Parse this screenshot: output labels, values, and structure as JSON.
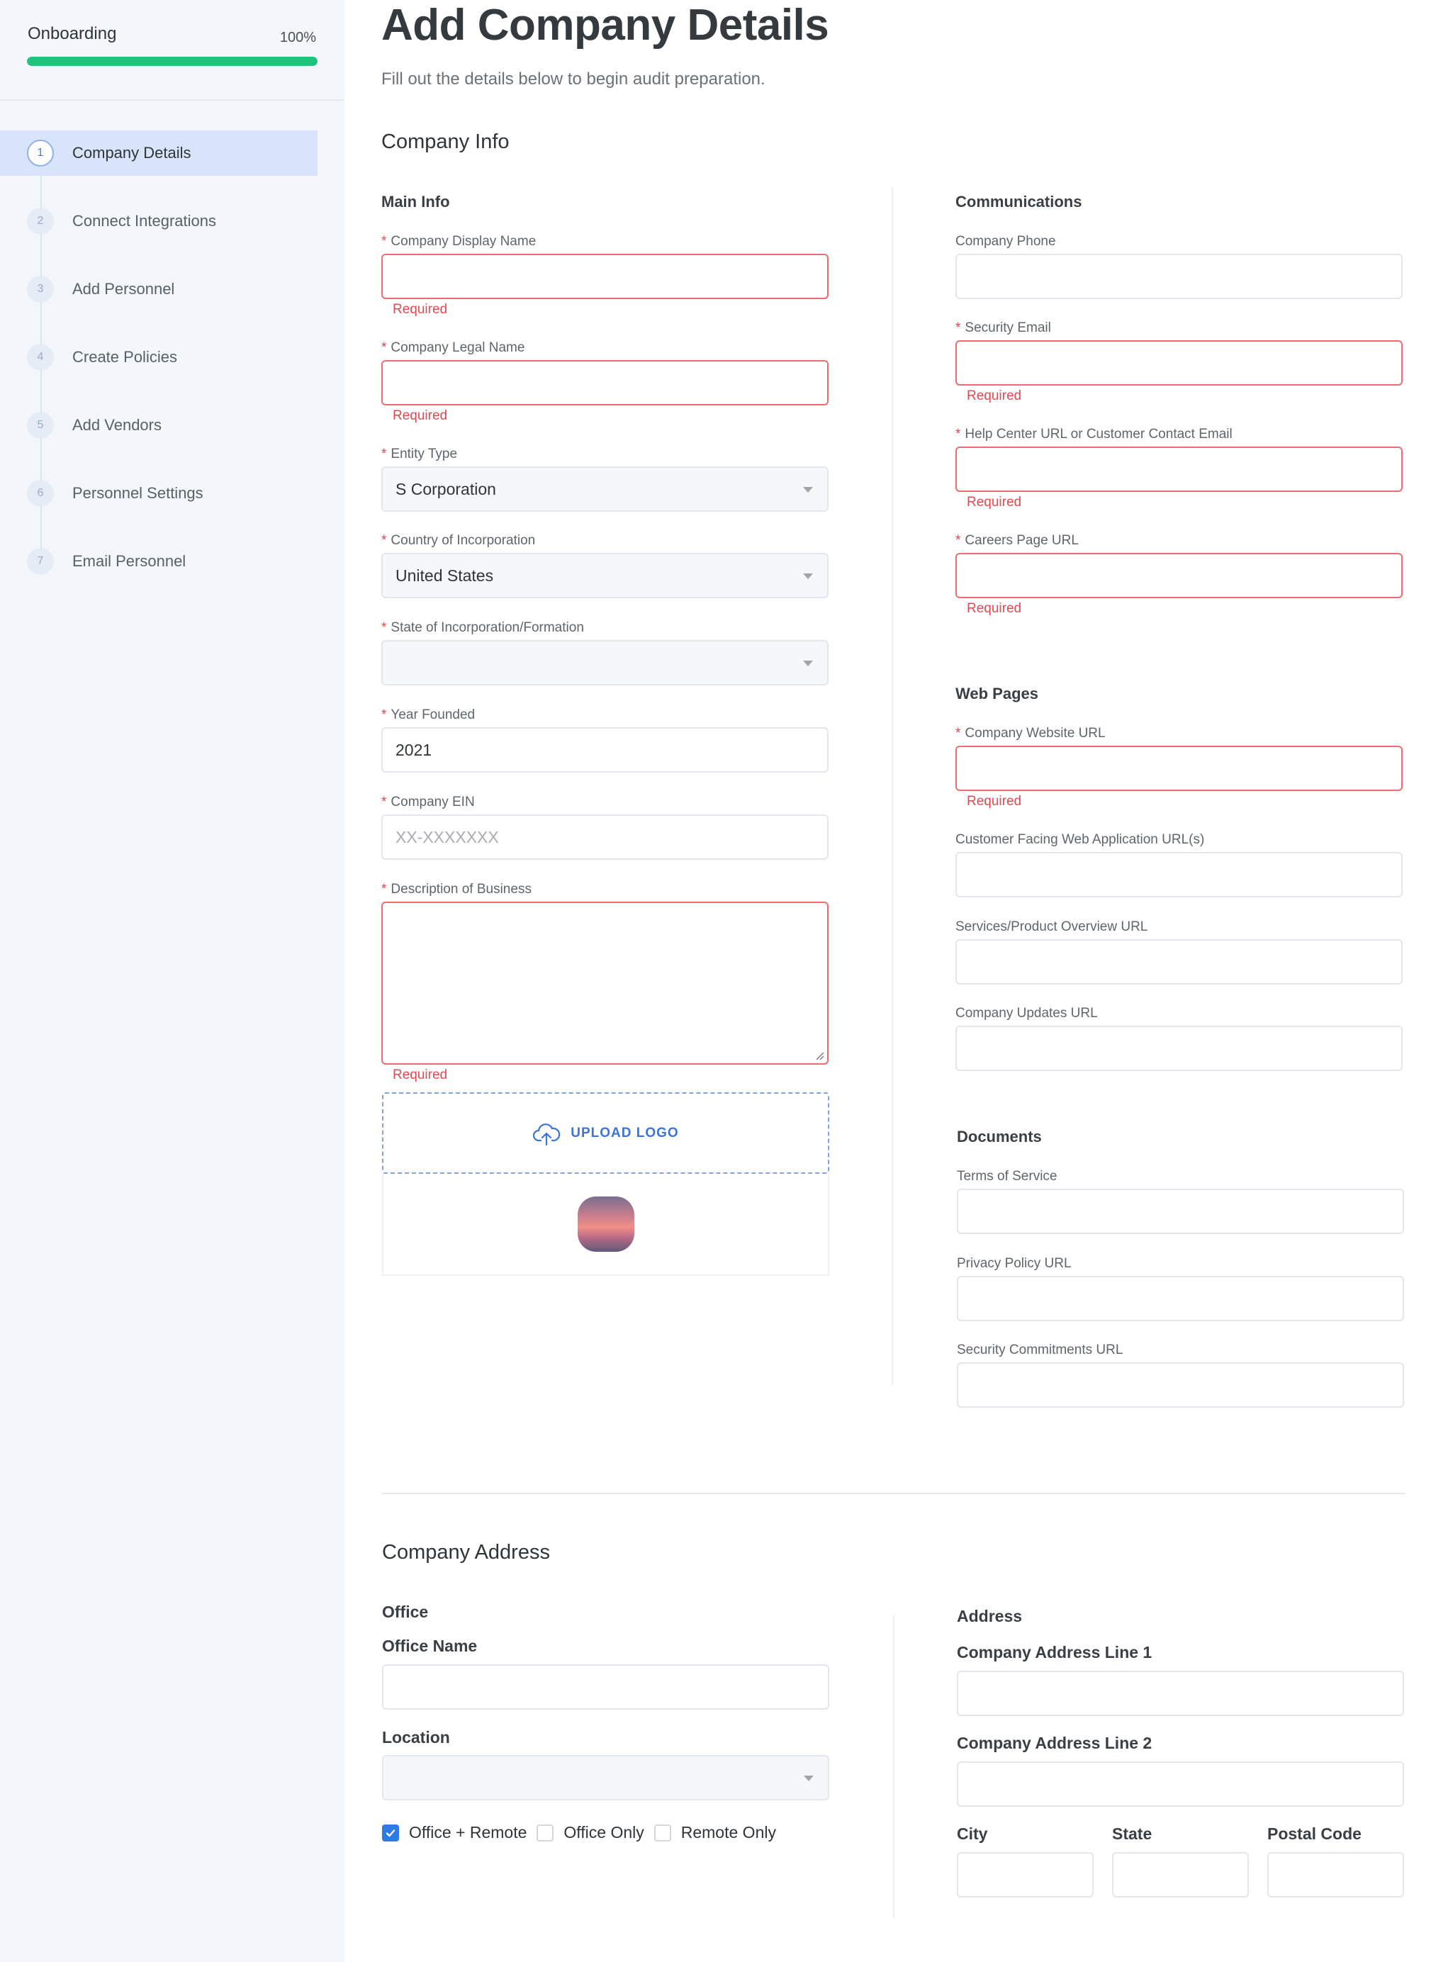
{
  "sidebar": {
    "title": "Onboarding",
    "progress_percent": "100%",
    "progress_value": 1.0,
    "steps": [
      {
        "num": "1",
        "label": "Company Details"
      },
      {
        "num": "2",
        "label": "Connect Integrations"
      },
      {
        "num": "3",
        "label": "Add Personnel"
      },
      {
        "num": "4",
        "label": "Create Policies"
      },
      {
        "num": "5",
        "label": "Add Vendors"
      },
      {
        "num": "6",
        "label": "Personnel Settings"
      },
      {
        "num": "7",
        "label": "Email Personnel"
      }
    ],
    "active_step": 1
  },
  "page": {
    "title": "Add Company Details",
    "subtitle": "Fill out the details below to begin audit preparation."
  },
  "company_info": {
    "title": "Company Info",
    "main_info": {
      "title": "Main Info",
      "display_name_label": "Company Display Name",
      "legal_name_label": "Company Legal Name",
      "entity_type_label": "Entity Type",
      "entity_type_value": "S Corporation",
      "country_label": "Country of Incorporation",
      "country_value": "United States",
      "state_label": "State of Incorporation/Formation",
      "state_value": "",
      "year_label": "Year Founded",
      "year_value": "2021",
      "ein_label": "Company EIN",
      "ein_placeholder": "XX-XXXXXXX",
      "description_label": "Description of Business",
      "upload_label": "UPLOAD LOGO"
    },
    "communications": {
      "title": "Communications",
      "phone_label": "Company Phone",
      "security_email_label": "Security Email",
      "help_center_label": "Help Center URL or Customer Contact Email",
      "careers_label": "Careers Page URL"
    },
    "web_pages": {
      "title": "Web Pages",
      "website_label": "Company Website URL",
      "web_app_label": "Customer Facing Web Application URL(s)",
      "overview_label": "Services/Product Overview URL",
      "updates_label": "Company Updates URL"
    },
    "documents": {
      "title": "Documents",
      "tos_label": "Terms of Service",
      "privacy_label": "Privacy Policy URL",
      "security_commitments_label": "Security Commitments URL"
    },
    "required_text": "Required",
    "required_marker": "*"
  },
  "company_address": {
    "title": "Company Address",
    "office": {
      "title": "Office",
      "name_label": "Office Name",
      "location_label": "Location",
      "options": [
        "Office + Remote",
        "Office Only",
        "Remote Only"
      ],
      "selected_option": "Office + Remote"
    },
    "address": {
      "title": "Address",
      "line1_label": "Company Address Line 1",
      "line2_label": "Company Address Line 2",
      "city_label": "City",
      "state_label": "State",
      "postal_label": "Postal Code"
    }
  },
  "colors": {
    "accent": "#2f7ae5",
    "progress": "#1fc37c",
    "error": "#e5484d",
    "sidebar_bg": "#f3f6fb",
    "active_step_bg": "#d8e4f9"
  }
}
